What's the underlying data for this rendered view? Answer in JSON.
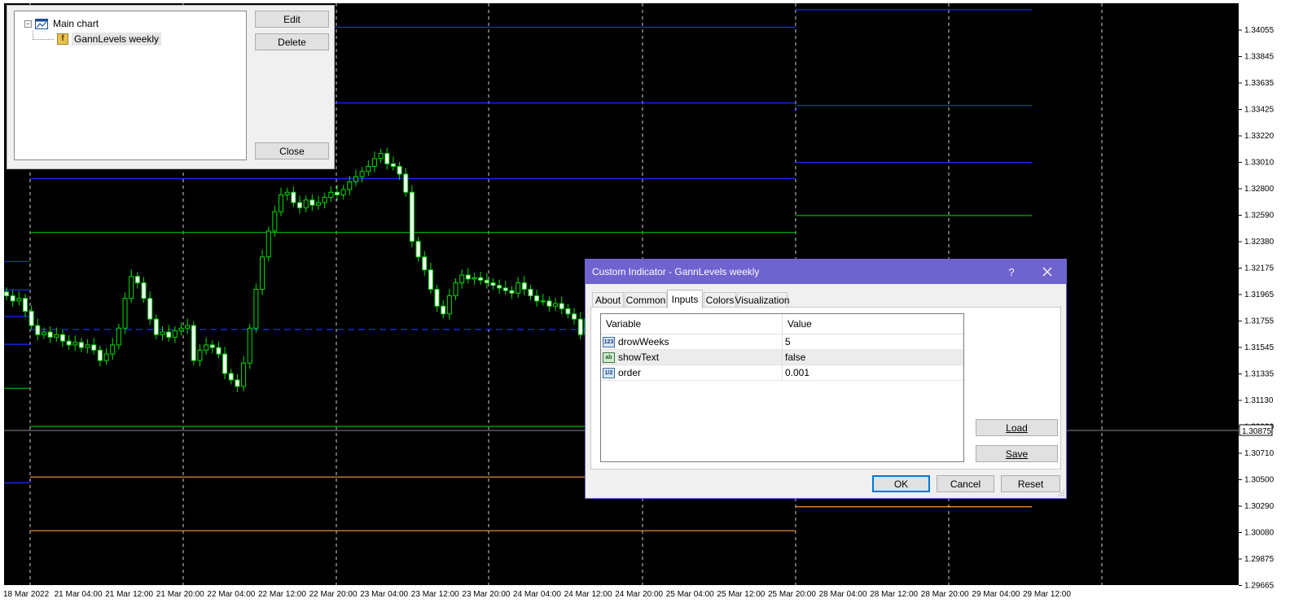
{
  "colors": {
    "background": "#000000",
    "grid": "#cfcfcf",
    "bull": "#00e000",
    "bear": "#ffffff",
    "blue_level": "#1a2fff",
    "green_level": "#00b000",
    "orange_level": "#ff9a3c",
    "axis_text": "#ffffff",
    "dialog_title": "#6f63d0"
  },
  "price_axis": {
    "labels": [
      "1.34055",
      "1.33845",
      "1.33635",
      "1.33425",
      "1.33220",
      "1.33010",
      "1.32800",
      "1.32590",
      "1.32380",
      "1.32175",
      "1.31965",
      "1.31755",
      "1.31545",
      "1.31335",
      "1.31130",
      "1.30920",
      "1.30710",
      "1.30500",
      "1.30290",
      "1.30080",
      "1.29875",
      "1.29665"
    ],
    "current_price": "1.30875"
  },
  "time_axis": {
    "labels": [
      "18 Mar 2022",
      "21 Mar 04:00",
      "21 Mar 12:00",
      "21 Mar 20:00",
      "22 Mar 04:00",
      "22 Mar 12:00",
      "22 Mar 20:00",
      "23 Mar 04:00",
      "23 Mar 12:00",
      "23 Mar 20:00",
      "24 Mar 04:00",
      "24 Mar 12:00",
      "24 Mar 20:00",
      "25 Mar 04:00",
      "25 Mar 12:00",
      "25 Mar 20:00",
      "28 Mar 04:00",
      "28 Mar 12:00",
      "28 Mar 20:00",
      "29 Mar 04:00",
      "29 Mar 12:00"
    ]
  },
  "chart_data": {
    "type": "candlestick",
    "x_labels": [
      "18 Mar 2022",
      "21 Mar 04:00",
      "21 Mar 12:00",
      "21 Mar 20:00",
      "22 Mar 04:00",
      "22 Mar 12:00",
      "22 Mar 20:00",
      "23 Mar 04:00",
      "23 Mar 12:00",
      "23 Mar 20:00",
      "24 Mar 04:00",
      "24 Mar 12:00",
      "24 Mar 20:00",
      "25 Mar 04:00",
      "25 Mar 12:00",
      "25 Mar 20:00",
      "28 Mar 04:00",
      "28 Mar 12:00",
      "28 Mar 20:00",
      "29 Mar 04:00",
      "29 Mar 12:00"
    ],
    "ylim": [
      1.29665,
      1.3416
    ],
    "close_series_hourly": [
      1.319,
      1.3186,
      1.3188,
      1.3178,
      1.3167,
      1.316,
      1.3162,
      1.3158,
      1.316,
      1.3155,
      1.3152,
      1.3154,
      1.315,
      1.3152,
      1.3148,
      1.314,
      1.3145,
      1.3152,
      1.3165,
      1.3188,
      1.3205,
      1.32,
      1.3188,
      1.3172,
      1.316,
      1.3162,
      1.3158,
      1.3163,
      1.3165,
      1.3167,
      1.314,
      1.3148,
      1.3152,
      1.315,
      1.3145,
      1.313,
      1.3125,
      1.312,
      1.3138,
      1.3165,
      1.3195,
      1.322,
      1.324,
      1.3255,
      1.3268,
      1.327,
      1.3262,
      1.3258,
      1.3264,
      1.326,
      1.3262,
      1.3266,
      1.327,
      1.3268,
      1.3272,
      1.3278,
      1.3282,
      1.3286,
      1.329,
      1.3296,
      1.33,
      1.3292,
      1.329,
      1.3284,
      1.327,
      1.3232,
      1.322,
      1.321,
      1.3195,
      1.3182,
      1.3176,
      1.319,
      1.32,
      1.3206,
      1.3203,
      1.3204,
      1.3202,
      1.32,
      1.3198,
      1.3196,
      1.3194,
      1.3192,
      1.32,
      1.3195,
      1.319,
      1.3186,
      1.3186,
      1.3182,
      1.3184,
      1.318,
      1.3176,
      1.3172,
      1.316,
      1.3172,
      1.3188,
      1.3196
    ],
    "levels": [
      {
        "segment": "week-1",
        "price": 1.32165,
        "color": "blue"
      },
      {
        "segment": "week-1",
        "price": 1.31945,
        "color": "blue"
      },
      {
        "segment": "week-1",
        "price": 1.3174,
        "color": "blue"
      },
      {
        "segment": "week-1",
        "price": 1.31525,
        "color": "blue"
      },
      {
        "segment": "week-1",
        "price": 1.31185,
        "color": "green"
      },
      {
        "segment": "week-1",
        "price": 1.30455,
        "color": "blue"
      },
      {
        "segment": "week-2",
        "price": 1.33975,
        "color": "blue"
      },
      {
        "segment": "week-2",
        "price": 1.3339,
        "color": "blue"
      },
      {
        "segment": "week-2",
        "price": 1.32805,
        "color": "blue"
      },
      {
        "segment": "week-2",
        "price": 1.3239,
        "color": "green"
      },
      {
        "segment": "week-2",
        "price": 1.3164,
        "color": "blue",
        "dashed": true
      },
      {
        "segment": "week-2",
        "price": 1.3089,
        "color": "green"
      },
      {
        "segment": "week-2",
        "price": 1.305,
        "color": "orange"
      },
      {
        "segment": "week-2",
        "price": 1.30085,
        "color": "orange"
      },
      {
        "segment": "week-3",
        "price": 1.3411,
        "color": "blue"
      },
      {
        "segment": "week-3",
        "price": 1.3337,
        "color": "blue"
      },
      {
        "segment": "week-3",
        "price": 1.3293,
        "color": "blue"
      },
      {
        "segment": "week-3",
        "price": 1.3252,
        "color": "green"
      },
      {
        "segment": "week-3",
        "price": 1.3027,
        "color": "orange"
      }
    ]
  },
  "indicators_window": {
    "tree": {
      "root_label": "Main chart",
      "expander": "−",
      "child_label": "GannLevels weekly",
      "child_icon_glyph": "f"
    },
    "buttons": {
      "edit": "Edit",
      "delete": "Delete",
      "close": "Close"
    }
  },
  "dialog": {
    "title": "Custom Indicator - GannLevels weekly",
    "help": "?",
    "tabs": [
      "About",
      "Common",
      "Inputs",
      "Colors",
      "Visualization"
    ],
    "active_tab": "Inputs",
    "grid": {
      "col_variable": "Variable",
      "col_value": "Value",
      "rows": [
        {
          "icon": "123",
          "name": "drowWeeks",
          "value": "5"
        },
        {
          "icon": "ab",
          "name": "showText",
          "value": "false"
        },
        {
          "icon": "1/2",
          "name": "order",
          "value": "0.001"
        }
      ]
    },
    "buttons": {
      "load": "Load",
      "save": "Save",
      "ok": "OK",
      "cancel": "Cancel",
      "reset": "Reset"
    }
  }
}
